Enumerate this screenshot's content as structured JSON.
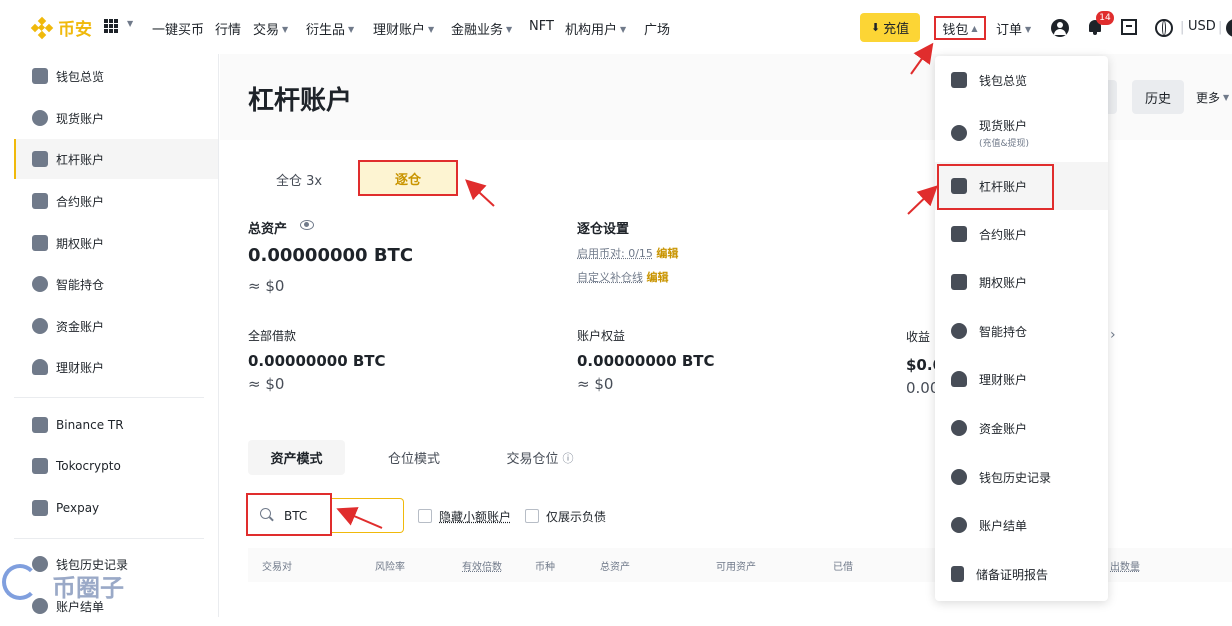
{
  "header": {
    "logo_text": "币安",
    "nav": [
      {
        "label": "一键买币",
        "caret": false
      },
      {
        "label": "行情",
        "caret": false
      },
      {
        "label": "交易",
        "caret": true
      },
      {
        "label": "衍生品",
        "caret": true
      },
      {
        "label": "理财账户",
        "caret": true
      },
      {
        "label": "金融业务",
        "caret": true
      },
      {
        "label": "NFT",
        "caret": false
      },
      {
        "label": "机构用户",
        "caret": true
      },
      {
        "label": "广场",
        "caret": false
      }
    ],
    "deposit_label": "充值",
    "wallet_label": "钱包",
    "orders_label": "订单",
    "notification_count": "14",
    "currency_label": "USD",
    "accent_color": "#F0B90B",
    "highlight_color": "#E02D2D"
  },
  "sidebar": {
    "items": [
      {
        "label": "钱包总览",
        "icon": "grid-icon"
      },
      {
        "label": "现货账户",
        "icon": "spot-icon"
      },
      {
        "label": "杠杆账户",
        "icon": "margin-icon",
        "active": true
      },
      {
        "label": "合约账户",
        "icon": "futures-icon"
      },
      {
        "label": "期权账户",
        "icon": "options-icon"
      },
      {
        "label": "智能持仓",
        "icon": "smart-icon"
      },
      {
        "label": "资金账户",
        "icon": "funding-icon"
      },
      {
        "label": "理财账户",
        "icon": "earn-icon"
      }
    ],
    "external": [
      {
        "label": "Binance TR",
        "icon": "exchange-icon"
      },
      {
        "label": "Tokocrypto",
        "icon": "exchange-icon"
      },
      {
        "label": "Pexpay",
        "icon": "exchange-icon"
      }
    ],
    "bottom": [
      {
        "label": "钱包历史记录",
        "icon": "history-icon"
      },
      {
        "label": "账户结单",
        "icon": "statement-icon"
      }
    ]
  },
  "main": {
    "title": "杠杆账户",
    "history_label": "历史",
    "more_label": "更多",
    "mode_tabs": {
      "cross": "全仓 3x",
      "isolated": "逐仓"
    },
    "total_assets_label": "总资产",
    "total_assets_value": "0.00000000 BTC",
    "total_assets_fiat": "≈ $0",
    "iso_settings_label": "逐仓设置",
    "enabled_pairs": "启用币对: 0/15",
    "edit_label": "编辑",
    "custom_margin_call": "自定义补仓线",
    "total_borrowed_label": "全部借款",
    "total_borrowed_value": "0.00000000 BTC",
    "total_borrowed_fiat": "≈ $0",
    "equity_label": "账户权益",
    "equity_value": "0.00000000 BTC",
    "equity_fiat": "≈ $0",
    "pnl_label": "收益",
    "pnl_value": "$0.0",
    "pnl_sub": "0.00",
    "asset_tabs": [
      "资产模式",
      "仓位模式",
      "交易仓位"
    ],
    "search_value": "BTC",
    "hide_small": "隐藏小额账户",
    "show_debt": "仅展示负债",
    "table_headers": [
      "交易对",
      "风险率",
      "有效倍数",
      "币种",
      "总资产",
      "可用资产",
      "已借",
      "出数量"
    ]
  },
  "dropdown": {
    "items": [
      {
        "label": "钱包总览",
        "icon": "grid-icon"
      },
      {
        "label": "现货账户",
        "sub": "(充值&提现)",
        "icon": "spot-icon"
      },
      {
        "label": "杠杆账户",
        "icon": "margin-icon",
        "highlighted": true
      },
      {
        "label": "合约账户",
        "icon": "futures-icon"
      },
      {
        "label": "期权账户",
        "icon": "options-icon"
      },
      {
        "label": "智能持仓",
        "icon": "smart-icon"
      },
      {
        "label": "理财账户",
        "icon": "earn-icon"
      },
      {
        "label": "资金账户",
        "icon": "funding-icon"
      },
      {
        "label": "钱包历史记录",
        "icon": "history-icon"
      },
      {
        "label": "账户结单",
        "icon": "statement-icon"
      },
      {
        "label": "储备证明报告",
        "icon": "report-icon"
      }
    ]
  },
  "watermark": "币圈子"
}
